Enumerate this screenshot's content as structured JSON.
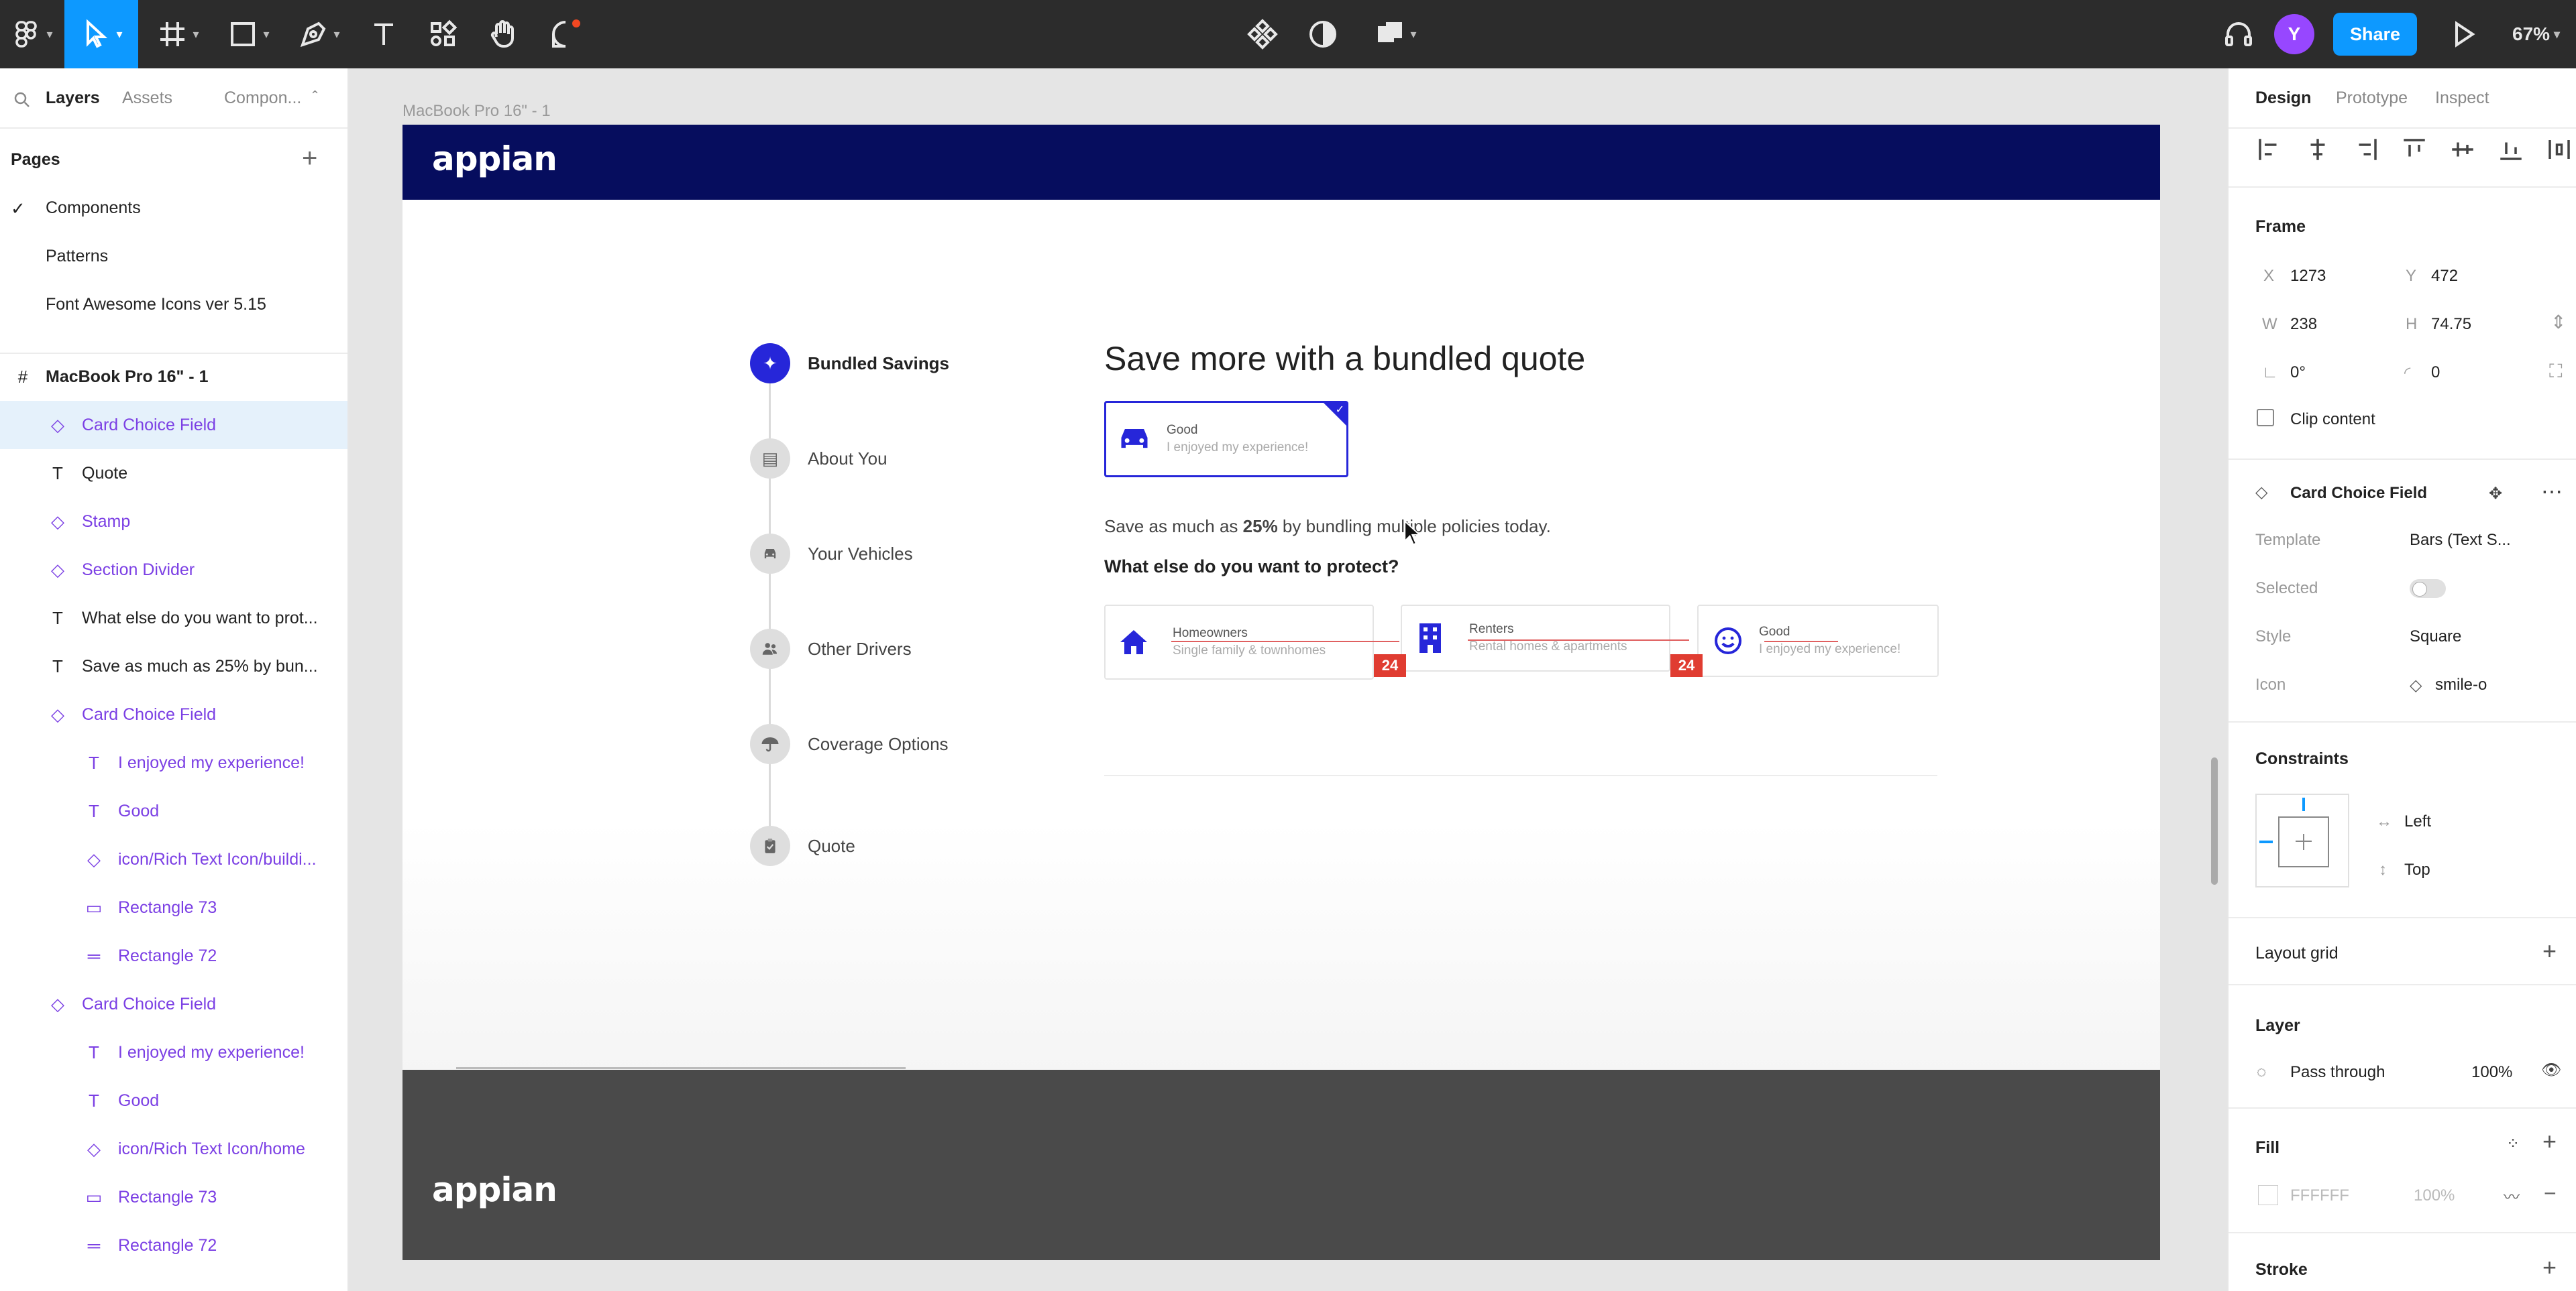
{
  "toolbar": {
    "share_label": "Share",
    "avatar_initial": "Y",
    "zoom": "67%",
    "accent": "#0d99ff"
  },
  "left_panel": {
    "tabs": [
      "Layers",
      "Assets",
      "Compon..."
    ],
    "pages_title": "Pages",
    "pages": [
      "Components",
      "Patterns",
      "Font Awesome Icons ver 5.15"
    ],
    "layers": [
      {
        "label": "MacBook Pro 16\" - 1",
        "icon": "frame-icon"
      },
      {
        "label": "Card Choice Field",
        "icon": "component-icon"
      },
      {
        "label": "Quote",
        "icon": "text-icon"
      },
      {
        "label": "Stamp",
        "icon": "component-icon"
      },
      {
        "label": "Section Divider",
        "icon": "component-icon"
      },
      {
        "label": "What else do you want to prot...",
        "icon": "text-icon"
      },
      {
        "label": "Save as much as 25% by bun...",
        "icon": "text-icon"
      },
      {
        "label": "Card Choice Field",
        "icon": "component-icon"
      },
      {
        "label": "I enjoyed my experience!",
        "icon": "text-icon"
      },
      {
        "label": "Good",
        "icon": "text-icon"
      },
      {
        "label": "icon/Rich Text Icon/buildi...",
        "icon": "component-icon"
      },
      {
        "label": "Rectangle 73",
        "icon": "rectangle-icon"
      },
      {
        "label": "Rectangle 72",
        "icon": "line-icon"
      },
      {
        "label": "Card Choice Field",
        "icon": "component-icon"
      },
      {
        "label": "I enjoyed my experience!",
        "icon": "text-icon"
      },
      {
        "label": "Good",
        "icon": "text-icon"
      },
      {
        "label": "icon/Rich Text Icon/home",
        "icon": "component-icon"
      },
      {
        "label": "Rectangle 73",
        "icon": "rectangle-icon"
      },
      {
        "label": "Rectangle 72",
        "icon": "line-icon"
      }
    ]
  },
  "right_panel": {
    "tabs": [
      "Design",
      "Prototype",
      "Inspect"
    ],
    "frame_title": "Frame",
    "x": "1273",
    "y": "472",
    "w": "238",
    "h": "74.75",
    "rotation": "0°",
    "radius": "0",
    "clip_content": "Clip content",
    "component_name": "Card Choice Field",
    "props": [
      {
        "label": "Template",
        "value": "Bars (Text S..."
      },
      {
        "label": "Selected",
        "value": ""
      },
      {
        "label": "Style",
        "value": "Square"
      },
      {
        "label": "Icon",
        "value": "smile-o"
      }
    ],
    "constraints_title": "Constraints",
    "constraint_h": "Left",
    "constraint_v": "Top",
    "layout_grid": "Layout grid",
    "layer_title": "Layer",
    "blend": "Pass through",
    "opacity": "100%",
    "fill_title": "Fill",
    "fill_hex": "FFFFFF",
    "fill_opacity": "100%",
    "stroke_title": "Stroke"
  },
  "canvas": {
    "frame_name": "MacBook Pro 16\" - 1",
    "brand": "appian",
    "brand_color": "#060d5e",
    "steps": [
      "Bundled Savings",
      "About You",
      "Your Vehicles",
      "Other Drivers",
      "Coverage Options",
      "Quote"
    ],
    "title": "Save more with a bundled quote",
    "selected_card": {
      "title": "Good",
      "subtitle": "I enjoyed my experience!"
    },
    "save_text_pre": "Save as much as ",
    "save_text_bold": "25%",
    "save_text_post": " by bundling multiple policies today.",
    "question": "What else do you want to protect?",
    "choices": [
      {
        "title": "Homeowners",
        "subtitle": "Single family & townhomes",
        "icon": "home-icon",
        "badge": "24"
      },
      {
        "title": "Renters",
        "subtitle": "Rental homes & apartments",
        "icon": "building-icon",
        "badge": "24"
      },
      {
        "title": "Good",
        "subtitle": "I enjoyed my experience!",
        "icon": "smile-icon",
        "badge": ""
      }
    ],
    "badge_color": "#e03c31"
  }
}
